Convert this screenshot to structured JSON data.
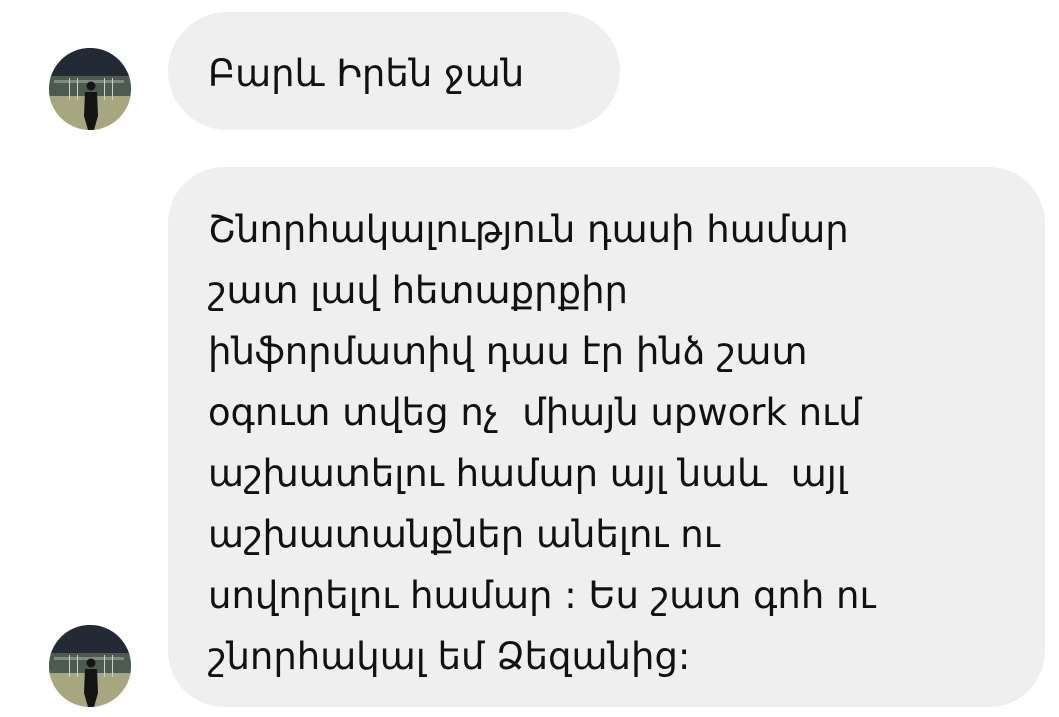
{
  "messages": [
    {
      "text": "Բարև Իրեն ջան"
    },
    {
      "lines": [
        "Շնորհակալություն դասի համար",
        "շատ լավ հետաքրքիր",
        "ինֆորմատիվ դաս էր ինձ շատ",
        "օգուտ տվեց ոչ  միայն upwork ում",
        "աշխատելու համար այլ նաև  այլ",
        "աշխատանքներ անելու ու",
        "սովորելու համար : Ես շատ գոհ ու",
        "շնորհակալ եմ Ձեզանից:"
      ]
    }
  ],
  "colors": {
    "bubble": "#efefef",
    "text": "#111111",
    "background": "#ffffff"
  }
}
